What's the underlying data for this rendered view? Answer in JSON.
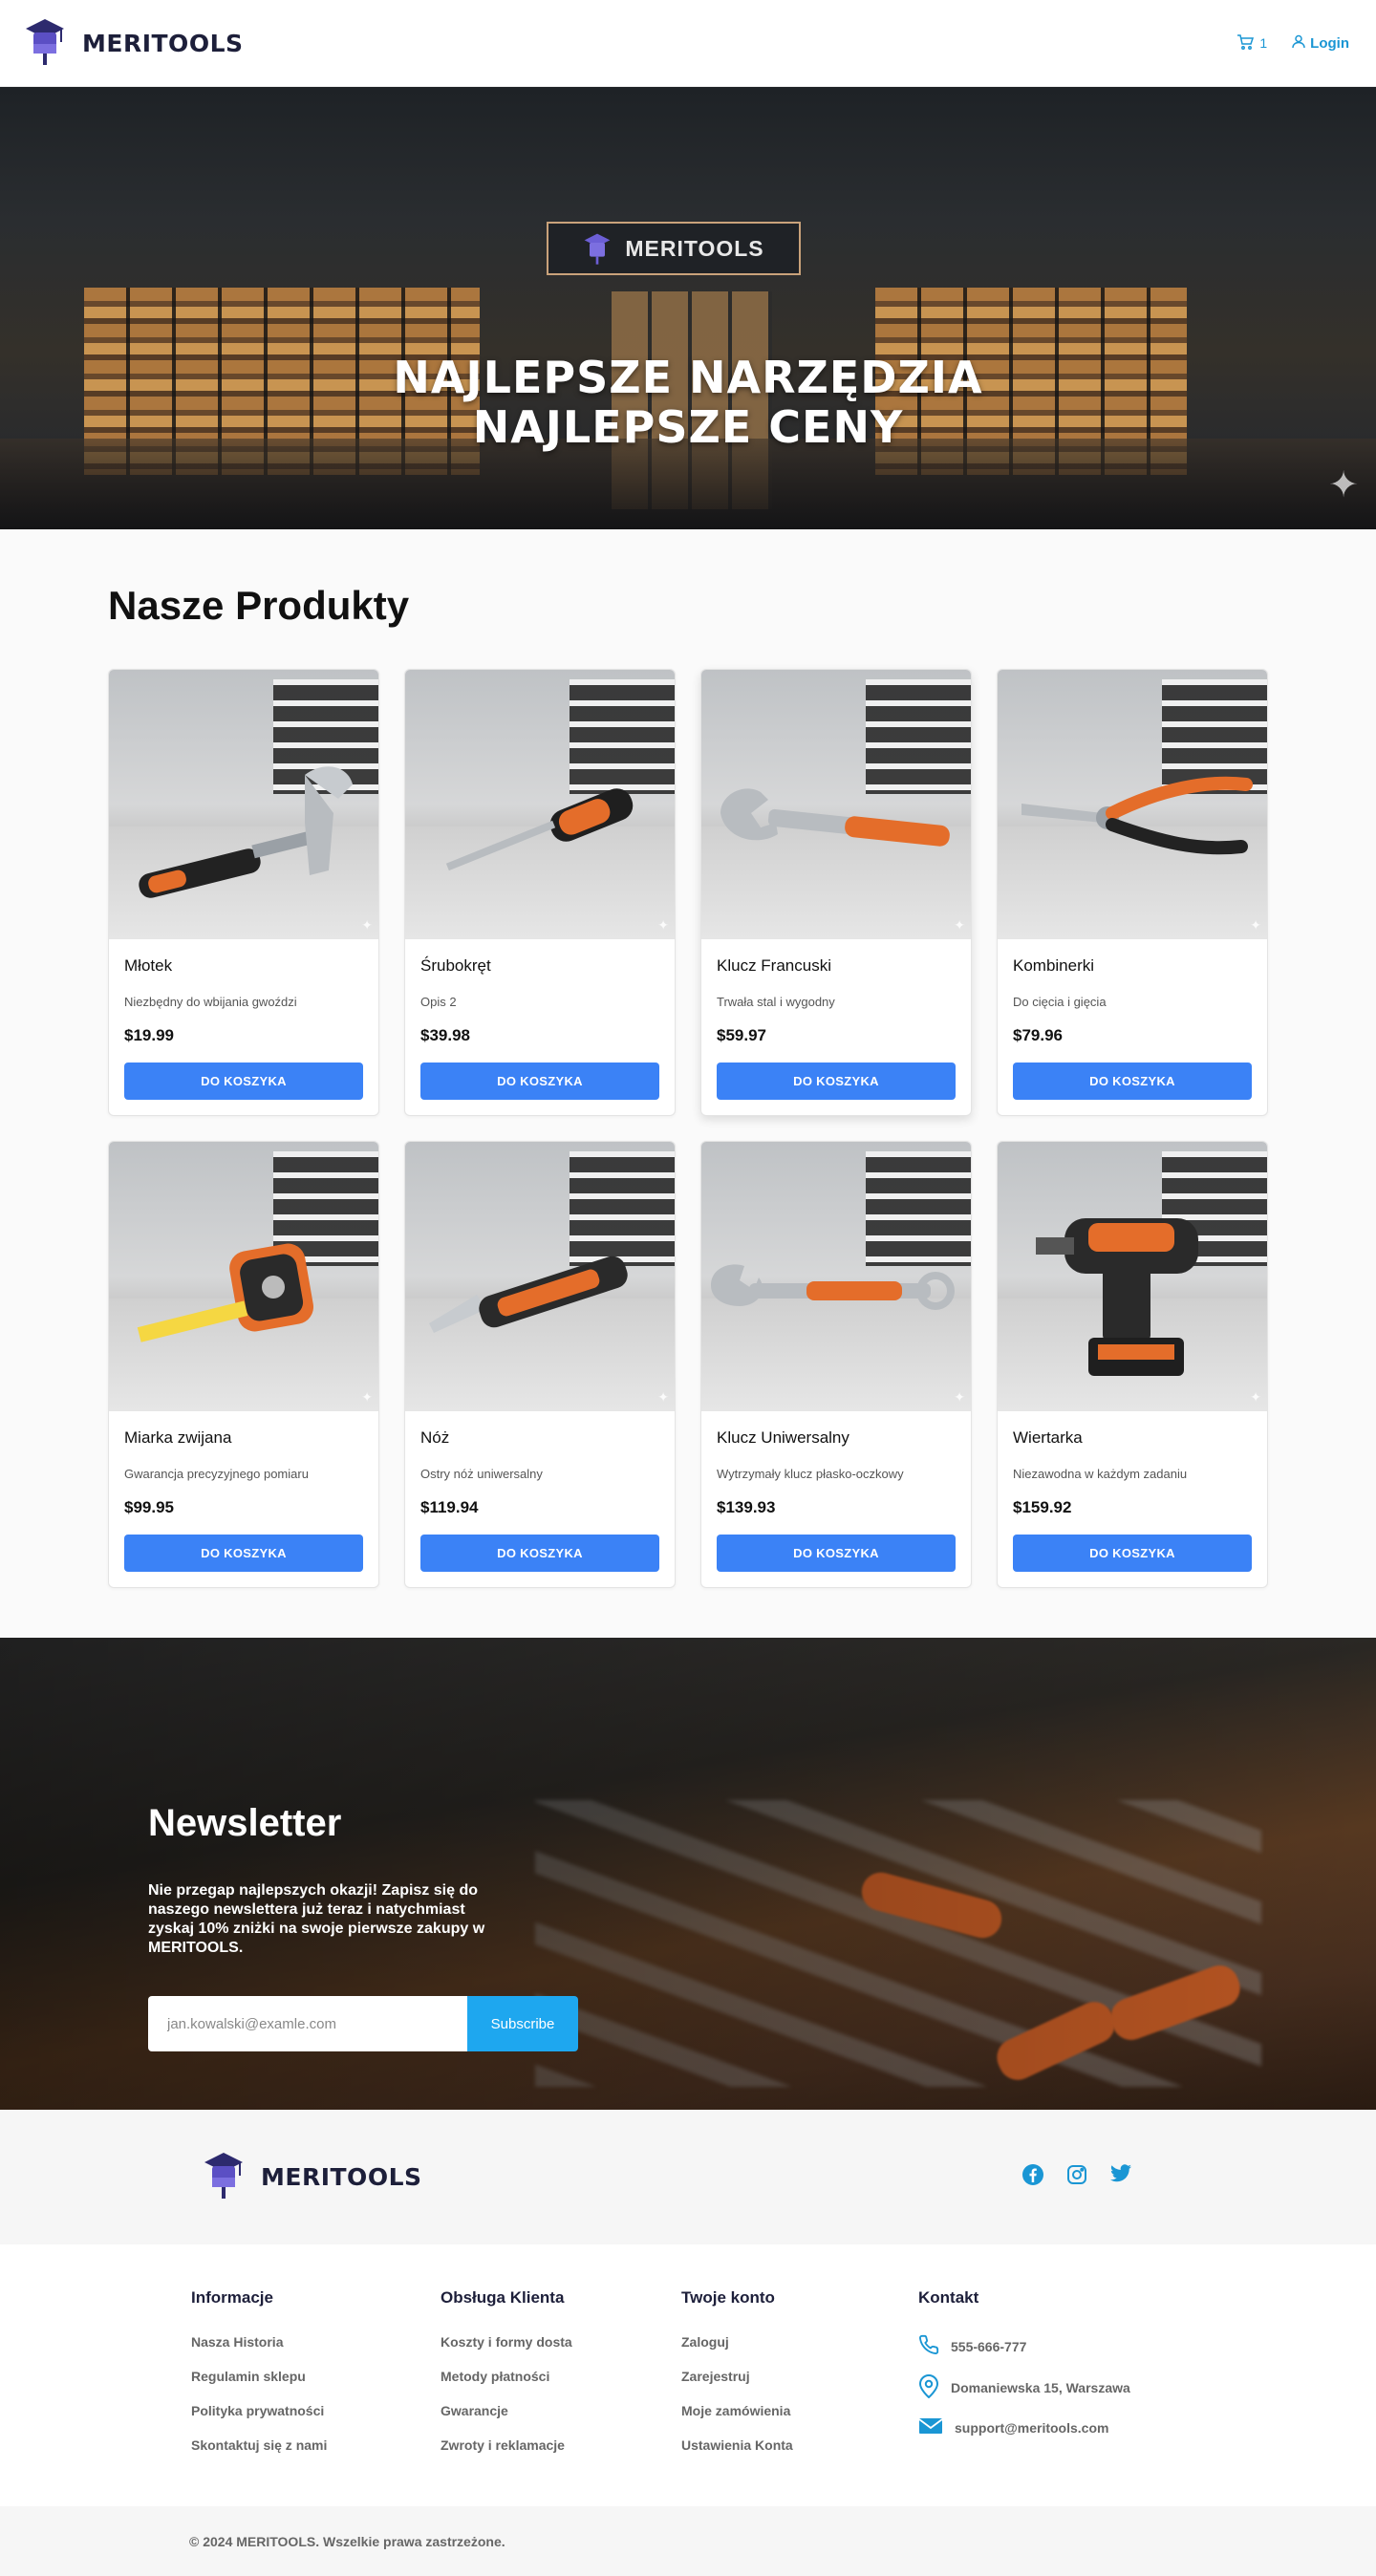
{
  "header": {
    "brand": "MERITOOLS",
    "cart_count": "1",
    "login_label": "Login"
  },
  "hero": {
    "sign_text": "MERITOOLS",
    "title_line1": "NAJLEPSZE NARZĘDZIA",
    "title_line2": "NAJLEPSZE CENY"
  },
  "products": {
    "title": "Nasze Produkty",
    "button_label": "DO KOSZYKA",
    "items": [
      {
        "name": "Młotek",
        "desc": "Niezbędny do wbijania gwoździ",
        "price": "$19.99",
        "tool": "hammer"
      },
      {
        "name": "Śrubokręt",
        "desc": "Opis 2",
        "price": "$39.98",
        "tool": "screwdriver"
      },
      {
        "name": "Klucz Francuski",
        "desc": "Trwała stal i wygodny",
        "price": "$59.97",
        "tool": "adjustable-wrench"
      },
      {
        "name": "Kombinerki",
        "desc": "Do cięcia i gięcia",
        "price": "$79.96",
        "tool": "pliers"
      },
      {
        "name": "Miarka zwijana",
        "desc": "Gwarancja precyzyjnego pomiaru",
        "price": "$99.95",
        "tool": "tape-measure"
      },
      {
        "name": "Nóż",
        "desc": "Ostry nóż uniwersalny",
        "price": "$119.94",
        "tool": "utility-knife"
      },
      {
        "name": "Klucz Uniwersalny",
        "desc": "Wytrzymały klucz płasko-oczkowy",
        "price": "$139.93",
        "tool": "combination-wrench"
      },
      {
        "name": "Wiertarka",
        "desc": "Niezawodna w każdym zadaniu",
        "price": "$159.92",
        "tool": "drill"
      }
    ]
  },
  "newsletter": {
    "title": "Newsletter",
    "text": "Nie przegap najlepszych okazji! Zapisz się do naszego newslettera już teraz i natychmiast zyskaj 10% zniżki na swoje pierwsze zakupy w MERITOOLS.",
    "placeholder": "jan.kowalski@examle.com",
    "button_label": "Subscribe"
  },
  "footer": {
    "brand": "MERITOOLS",
    "socials": [
      "facebook-icon",
      "instagram-icon",
      "twitter-icon"
    ],
    "columns": [
      {
        "title": "Informacje",
        "links": [
          "Nasza Historia",
          "Regulamin sklepu",
          "Polityka prywatności",
          "Skontaktuj się z nami"
        ]
      },
      {
        "title": "Obsługa Klienta",
        "links": [
          "Koszty i formy dosta",
          "Metody płatności",
          "Gwarancje",
          "Zwroty i reklamacje"
        ]
      },
      {
        "title": "Twoje konto",
        "links": [
          "Zaloguj",
          "Zarejestruj",
          "Moje zamówienia",
          "Ustawienia Konta"
        ]
      }
    ],
    "contact": {
      "title": "Kontakt",
      "phone": "555-666-777",
      "address": "Domaniewska 15, Warszawa",
      "email": "support@meritools.com"
    },
    "copyright": "© 2024 MERITOOLS. Wszelkie prawa zastrzeżone."
  },
  "colors": {
    "accent": "#1a96d4",
    "button": "#3b82f6",
    "subscribe": "#1ea7ef",
    "brand_dark": "#1d1f3a"
  }
}
